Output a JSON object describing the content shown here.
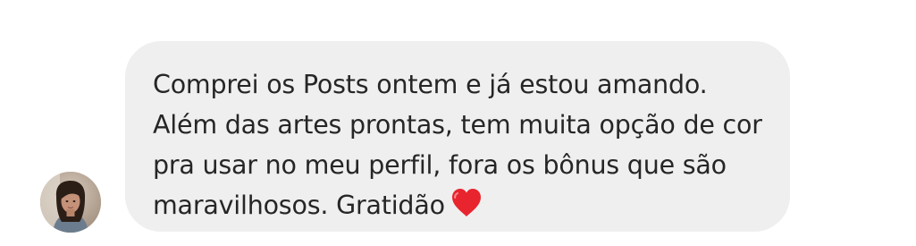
{
  "message": {
    "text": "Comprei os Posts ontem e já estou amando. Além das artes prontas, tem muita opção de cor pra usar no meu perfil, fora os bônus que são maravilhosos. Gratidão",
    "emoji": "heart-icon",
    "emoji_color": "#e8242f"
  },
  "sender": {
    "avatar": "avatar"
  },
  "colors": {
    "bubble_background": "#efefef",
    "text": "#262626",
    "page_background": "#ffffff"
  }
}
